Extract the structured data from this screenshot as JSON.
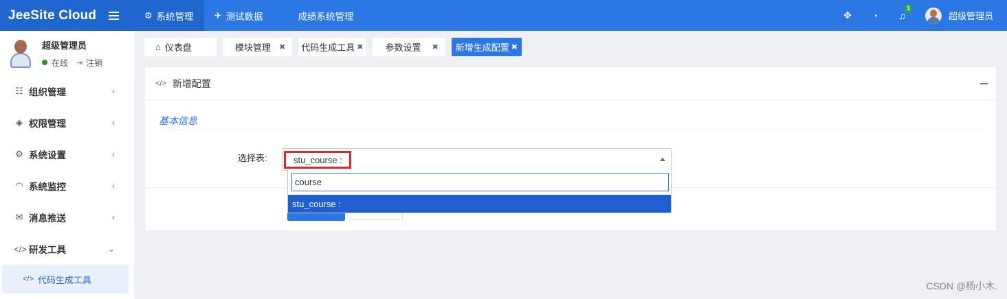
{
  "app": {
    "brand": "JeeSite Cloud"
  },
  "topnav": {
    "items": [
      {
        "label": "系统管理",
        "icon": "gear-icon"
      },
      {
        "label": "测试数据",
        "icon": "paper-plane-icon"
      },
      {
        "label": "成绩系统管理",
        "icon": ""
      }
    ],
    "notification_count": "1",
    "user_name": "超级管理员"
  },
  "sidebar": {
    "user_name": "超级管理员",
    "status_online": "在线",
    "logout": "注销",
    "menu": [
      {
        "label": "组织管理",
        "icon": "grid-icon"
      },
      {
        "label": "权限管理",
        "icon": "layers-icon"
      },
      {
        "label": "系统设置",
        "icon": "gear-icon"
      },
      {
        "label": "系统监控",
        "icon": "ghost-icon"
      },
      {
        "label": "消息推送",
        "icon": "envelope-icon"
      },
      {
        "label": "研发工具",
        "icon": "code-icon"
      }
    ],
    "submenu": [
      {
        "label": "代码生成工具",
        "icon": "code-icon"
      }
    ]
  },
  "tabs": [
    {
      "label": "仪表盘"
    },
    {
      "label": "模块管理"
    },
    {
      "label": "代码生成工具"
    },
    {
      "label": "参数设置"
    },
    {
      "label": "新增生成配置"
    }
  ],
  "main": {
    "box_title": "新增配置",
    "section_title": "基本信息",
    "select_label": "选择表:",
    "select_value": "stu_course :",
    "search_value": "course",
    "option": "stu_course :"
  },
  "watermark": "CSDN @杨小木."
}
